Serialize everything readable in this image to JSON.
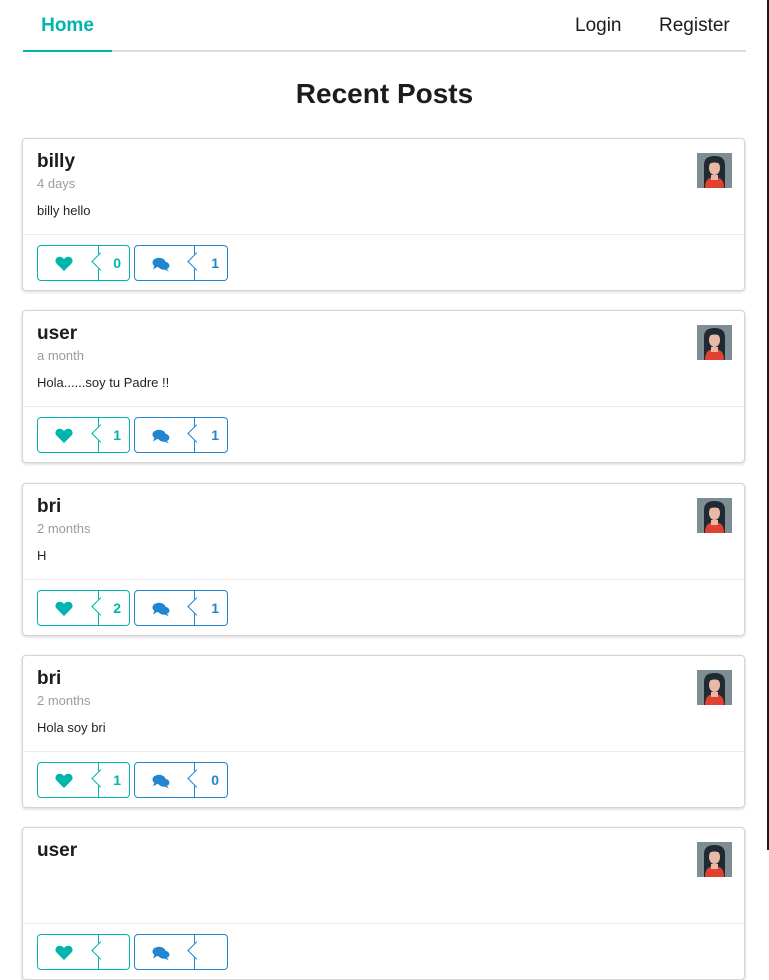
{
  "nav": {
    "home": "Home",
    "login": "Login",
    "register": "Register"
  },
  "page_title": "Recent Posts",
  "posts": [
    {
      "username": "billy",
      "time": "4 days",
      "body": "billy hello",
      "likes": "0",
      "comments": "1"
    },
    {
      "username": "user",
      "time": "a month",
      "body": "Hola......soy tu Padre !!",
      "likes": "1",
      "comments": "1"
    },
    {
      "username": "bri",
      "time": "2 months",
      "body": "H",
      "likes": "2",
      "comments": "1"
    },
    {
      "username": "bri",
      "time": "2 months",
      "body": "Hola soy bri",
      "likes": "1",
      "comments": "0"
    },
    {
      "username": "user",
      "time": "",
      "body": "",
      "likes": "",
      "comments": ""
    }
  ],
  "icons": {
    "like": "heart-icon",
    "comment": "comments-icon",
    "avatar": "user-avatar"
  },
  "colors": {
    "accent_teal": "#00b5ad",
    "accent_blue": "#2185d0"
  }
}
